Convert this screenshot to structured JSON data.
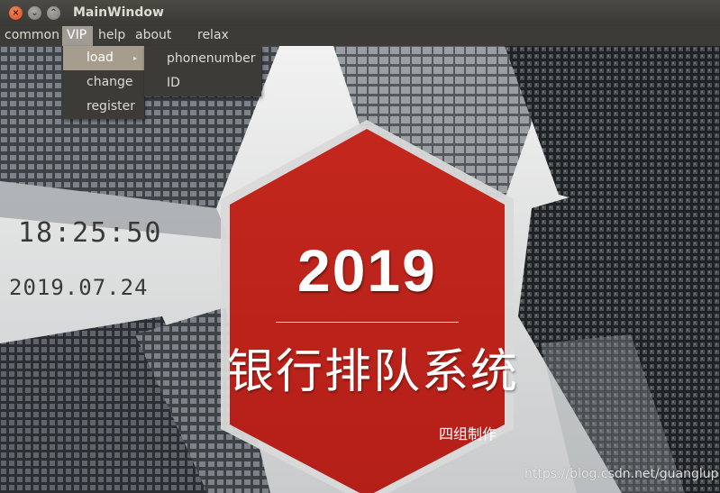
{
  "window": {
    "title": "MainWindow",
    "controls": {
      "close": "×",
      "minimize": "⌄",
      "maximize": "⌃"
    }
  },
  "menubar": {
    "items": [
      {
        "label": "common"
      },
      {
        "label": "VIP",
        "active": true
      },
      {
        "label": "help"
      },
      {
        "label": "about us"
      },
      {
        "label": "relax"
      }
    ]
  },
  "vip_menu": {
    "items": [
      {
        "label": "load",
        "has_submenu": true
      },
      {
        "label": "change"
      },
      {
        "label": "register"
      }
    ],
    "submenu_arrow": "▸"
  },
  "load_submenu": {
    "items": [
      {
        "label": "phonenumber"
      },
      {
        "label": "ID"
      }
    ]
  },
  "main": {
    "time": "18:25:50",
    "date": "2019.07.24",
    "banner": {
      "year": "2019",
      "system_title": "银行排队系统",
      "credit": "四组制作"
    },
    "watermark": "https://blog.csdn.net/guanglup"
  },
  "colors": {
    "hexagon_red": "#c1241c",
    "menubar_bg": "#3c3b37",
    "menu_active": "#a19c93",
    "titlebar_close": "#e05a2b"
  }
}
